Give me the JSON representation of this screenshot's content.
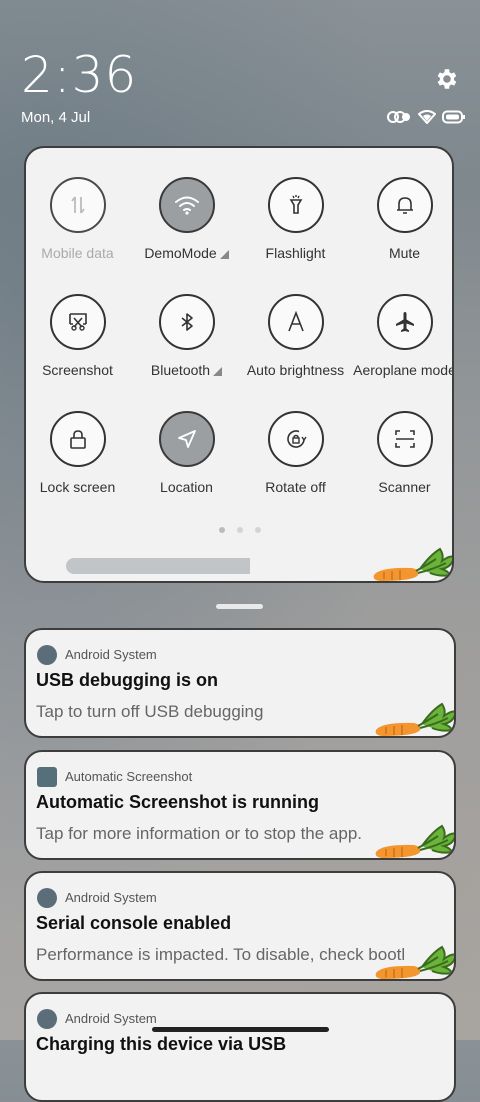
{
  "lockscreen": {
    "time": "2:36",
    "date": "Mon, 4 Jul"
  },
  "colors": {
    "panel": "#f2f2f2",
    "border": "#3d3d3d",
    "tile_on": "#9c9fa2",
    "carrot": "#f3962f",
    "leaf": "#6ab43a"
  },
  "quick_tiles": [
    {
      "label": "Mobile data",
      "icon": "mobile-data-icon",
      "state": "disabled"
    },
    {
      "label": "DemoMode",
      "icon": "wifi-icon",
      "state": "on",
      "expand": true
    },
    {
      "label": "Flashlight",
      "icon": "flashlight-icon",
      "state": "off"
    },
    {
      "label": "Mute",
      "icon": "bell-icon",
      "state": "off"
    },
    {
      "label": "Screenshot",
      "icon": "screenshot-icon",
      "state": "off"
    },
    {
      "label": "Bluetooth",
      "icon": "bluetooth-icon",
      "state": "off",
      "expand": true
    },
    {
      "label": "Auto brightness",
      "icon": "auto-brightness-icon",
      "state": "off"
    },
    {
      "label": "Aeroplane mode",
      "icon": "airplane-icon",
      "state": "off"
    },
    {
      "label": "Lock screen",
      "icon": "lock-icon",
      "state": "off"
    },
    {
      "label": "Location",
      "icon": "location-icon",
      "state": "on"
    },
    {
      "label": "Rotate off",
      "icon": "rotate-lock-icon",
      "state": "off"
    },
    {
      "label": "Scanner",
      "icon": "scanner-icon",
      "state": "off"
    }
  ],
  "pager": {
    "pages": 3,
    "current": 1
  },
  "notifications": [
    {
      "app": "Android System",
      "title": "USB debugging is on",
      "body": "Tap to turn off USB debugging"
    },
    {
      "app": "Automatic Screenshot",
      "title": "Automatic Screenshot is running",
      "body": "Tap for more information or to stop the app."
    },
    {
      "app": "Android System",
      "title": "Serial console enabled",
      "body": "Performance is impacted. To disable, check bootl"
    },
    {
      "app": "Android System",
      "title": "Charging this device via USB",
      "body": ""
    }
  ]
}
